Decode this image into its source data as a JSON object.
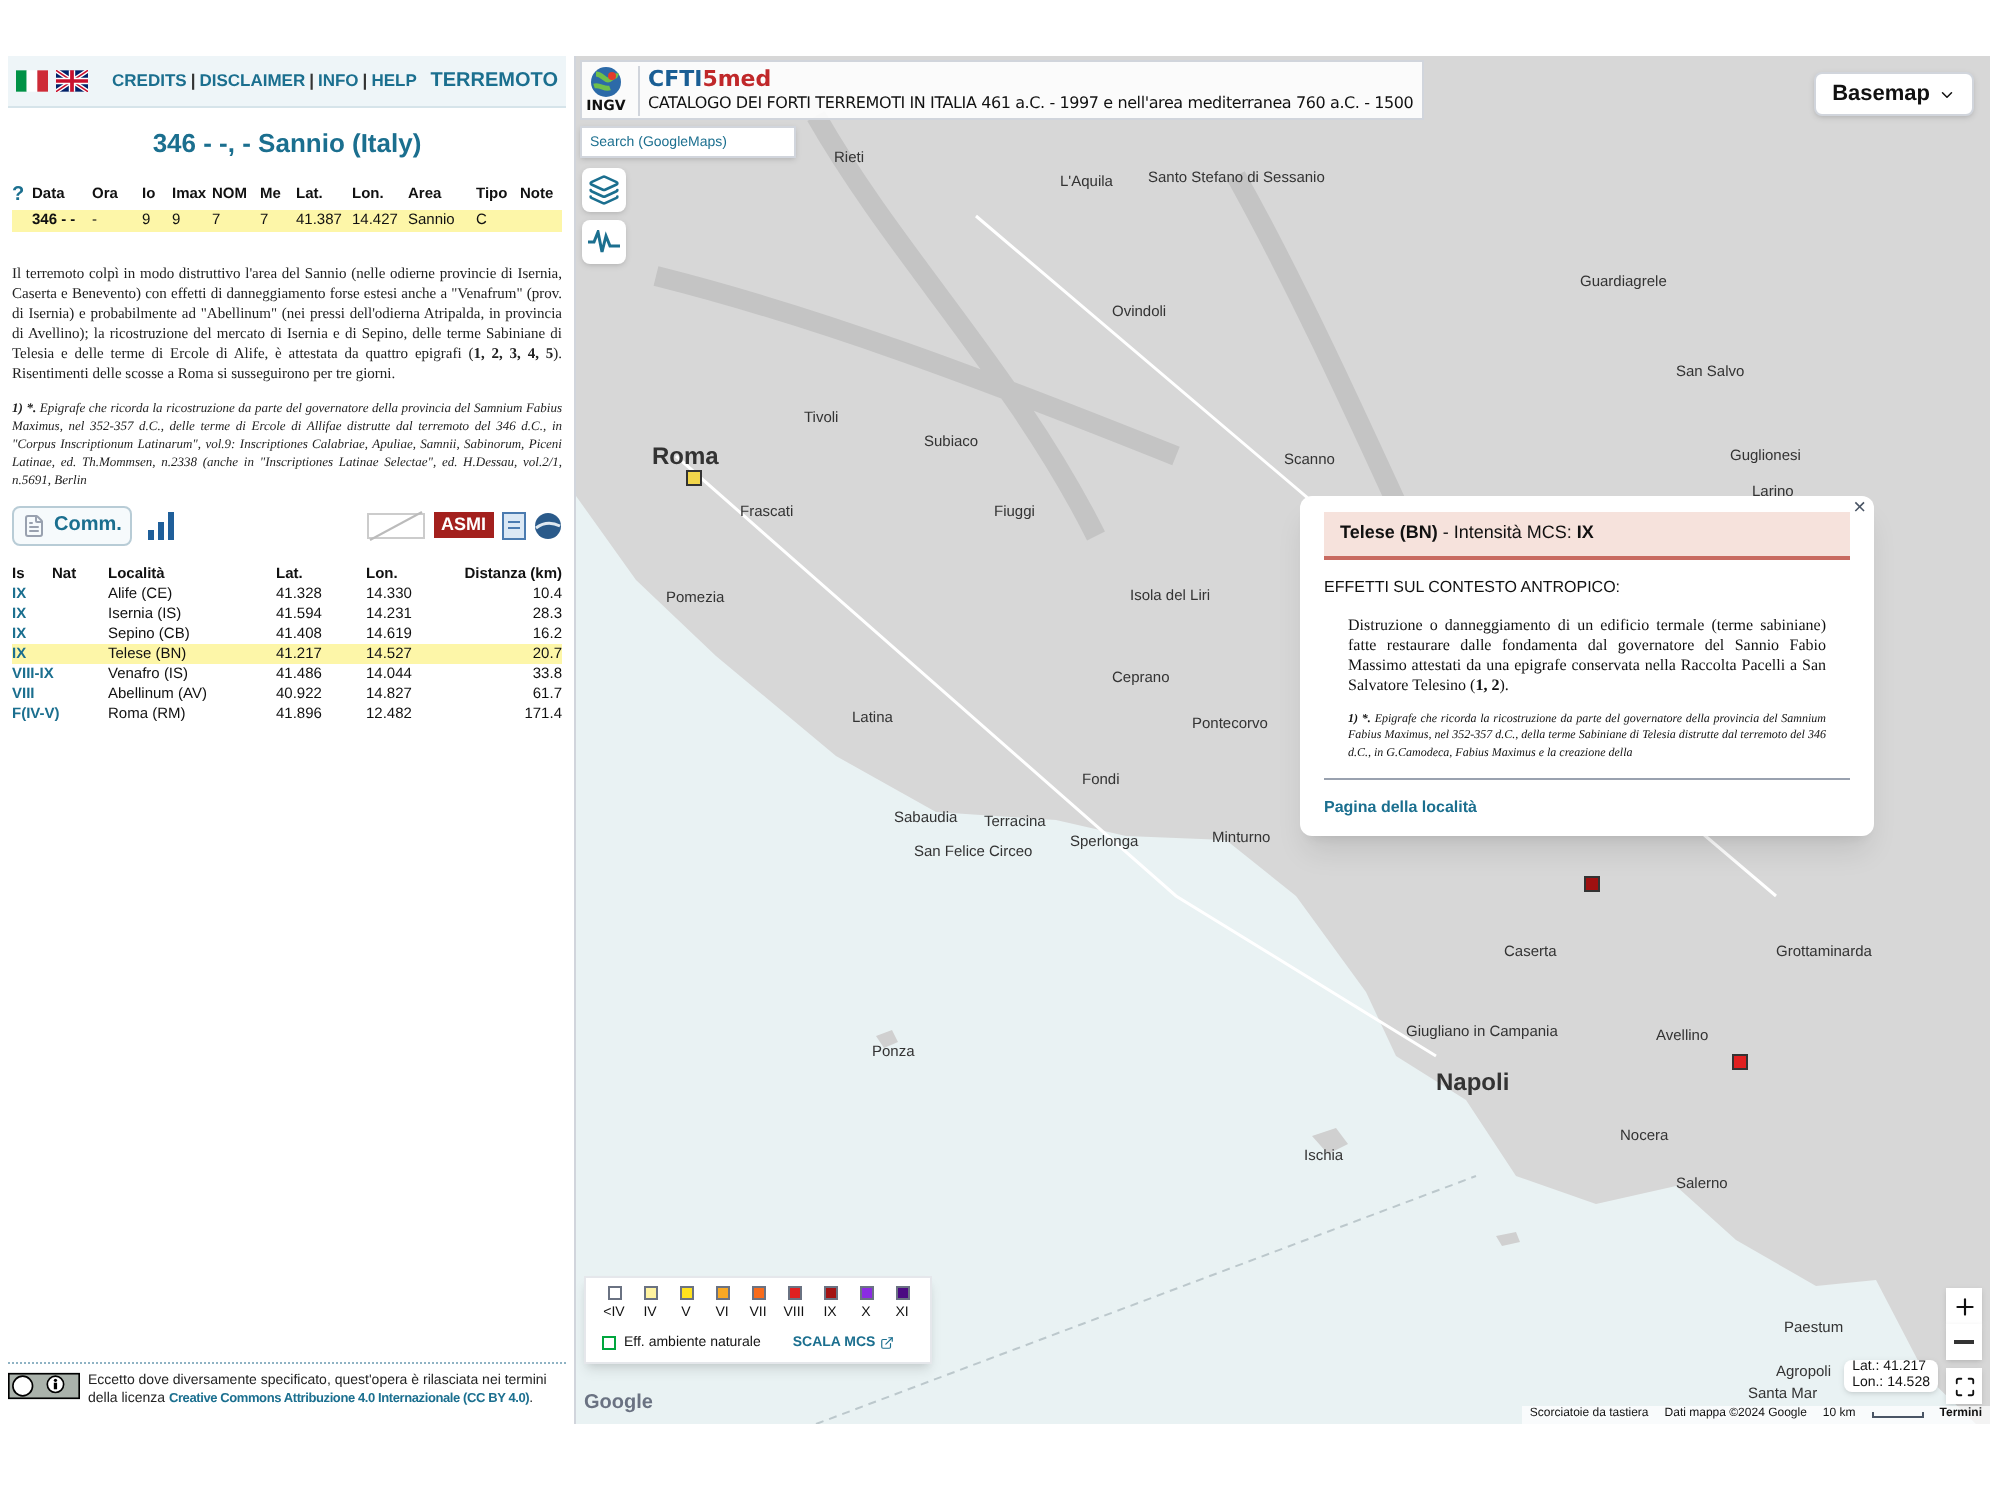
{
  "nav": {
    "links": [
      "CREDITS",
      "DISCLAIMER",
      "INFO",
      "HELP"
    ],
    "separators": [
      "|",
      "|",
      "|"
    ],
    "section": "TERREMOTO"
  },
  "quake": {
    "title": "346 - -, - Sannio (Italy)",
    "help": "?",
    "columns": [
      "Data",
      "Ora",
      "Io",
      "Imax",
      "NOM",
      "Me",
      "Lat.",
      "Lon.",
      "Area",
      "Tipo",
      "Note"
    ],
    "row": [
      "346 - -",
      "-",
      "9",
      "9",
      "7",
      "7",
      "41.387",
      "14.427",
      "Sannio",
      "C"
    ]
  },
  "description": "Il terremoto colpì in modo distruttivo l'area del Sannio (nelle odierne provincie di Isernia, Caserta e Benevento) con effetti di danneggiamento forse estesi anche a \"Venafrum\" (prov. di Isernia) e probabilmente ad \"Abellinum\" (nei pressi dell'odierna Atripalda, in provincia di Avellino); la ricostruzione del mercato di Isernia e di Sepino, delle terme Sabiniane di Telesia e delle terme di Ercole di Alife, è attestata da quattro epigrafi (**1, 2, 3, 4, 5**). Risentimenti delle scosse a Roma si susseguirono per tre giorni.",
  "footnote": {
    "mark": "1) *.",
    "text": "Epigrafe che ricorda la ricostruzione da parte del governatore della provincia del Samnium Fabius Maximus, nel 352-357 d.C., delle terme di Ercole di Allifae distrutte dal terremoto del 346 d.C., in \"Corpus Inscriptionum Latinarum\", vol.9: Inscriptiones Calabriae, Apuliae, Samnii, Sabinorum, Piceni Latinae, ed. Th.Mommsen, n.2338 (anche in \"Inscriptiones Latinae Selectae\", ed. H.Dessau, vol.2/1, n.5691, Berlin"
  },
  "comm_button": "Comm.",
  "logo_text": "ASMI",
  "localities": {
    "columns": [
      "Is",
      "Nat",
      "Località",
      "Lat.",
      "Lon.",
      "Distanza (km)"
    ],
    "rows": [
      {
        "is": "IX",
        "name": "Alife (CE)",
        "lat": "41.328",
        "lon": "14.330",
        "dist": "10.4",
        "selected": false
      },
      {
        "is": "IX",
        "name": "Isernia (IS)",
        "lat": "41.594",
        "lon": "14.231",
        "dist": "28.3",
        "selected": false
      },
      {
        "is": "IX",
        "name": "Sepino (CB)",
        "lat": "41.408",
        "lon": "14.619",
        "dist": "16.2",
        "selected": false
      },
      {
        "is": "IX",
        "name": "Telese (BN)",
        "lat": "41.217",
        "lon": "14.527",
        "dist": "20.7",
        "selected": true
      },
      {
        "is": "VIII-IX",
        "name": "Venafro (IS)",
        "lat": "41.486",
        "lon": "14.044",
        "dist": "33.8",
        "selected": false
      },
      {
        "is": "VIII",
        "name": "Abellinum (AV)",
        "lat": "40.922",
        "lon": "14.827",
        "dist": "61.7",
        "selected": false
      },
      {
        "is": "F(IV-V)",
        "name": "Roma (RM)",
        "lat": "41.896",
        "lon": "12.482",
        "dist": "171.4",
        "selected": false
      }
    ]
  },
  "license": {
    "text": "Eccetto dove diversamente specificato, quest'opera è rilasciata nei termini della licenza ",
    "link": "Creative Commons Attribuzione 4.0 Internazionale (CC BY 4.0)",
    "end": "."
  },
  "map": {
    "logo_text": "INGV",
    "brand": [
      "CFTI",
      "5med"
    ],
    "subtitle": "CATALOGO DEI FORTI TERREMOTI IN ITALIA 461 a.C. - 1997 e nell'area mediterranea 760 a.C. - 1500",
    "search": {
      "placeholder": "Search (GoogleMaps)"
    },
    "basemap": "Basemap",
    "labels": [
      "Rieti",
      "L'Aquila",
      "Santo Stefano di Sessanio",
      "Ovindoli",
      "Guardiagrele",
      "San Salvo",
      "Tivoli",
      "Subiaco",
      "Roma",
      "Scanno",
      "Guglionesi",
      "Larino",
      "Frascati",
      "Fiuggi",
      "Pomezia",
      "Isola del Liri",
      "Ceprano",
      "Latina",
      "Pontecorvo",
      "Fondi",
      "Sabaudia",
      "Terracina",
      "Minturno",
      "Sperlonga",
      "San Felice Circeo",
      "Caserta",
      "Grottaminarda",
      "Giugliano in Campania",
      "Avellino",
      "Ponza",
      "Napoli",
      "Nocera",
      "Ischia",
      "Salerno",
      "Paestum",
      "Agropoli",
      "Santa Mar"
    ],
    "markers": [
      {
        "color": "#f2d64b"
      },
      {
        "color": "#a01010"
      },
      {
        "color": "#e02020"
      }
    ],
    "popup": {
      "close": "×",
      "title": "**Telese (BN)** - Intensità MCS: **IX**",
      "heading": "EFFETTI SUL CONTESTO ANTROPICO:",
      "text": "Distruzione o danneggiamento di un edificio termale (terme sabiniane) fatte restaurare dalle fondamenta dal governatore del Sannio Fabio Massimo attestati da una epigrafe conservata nella Raccolta Pacelli a San Salvatore Telesino (**1, 2**).",
      "note_mark": "1) *.",
      "note": "Epigrafe che ricorda la ricostruzione da parte del governatore della provincia del Samnium Fabius Maximus, nel 352-357 d.C., della terme Sabiniane di Telesia distrutte dal terremoto del 346 d.C., in G.Camodeca, Fabius Maximus e la creazione della",
      "link": "Pagina della località"
    },
    "legend": {
      "levels": [
        {
          "label": "<IV",
          "color": "#ffffff"
        },
        {
          "label": "IV",
          "color": "#fff3a0"
        },
        {
          "label": "V",
          "color": "#ffe21f"
        },
        {
          "label": "VI",
          "color": "#f7a824"
        },
        {
          "label": "VII",
          "color": "#f76b1c"
        },
        {
          "label": "VIII",
          "color": "#e02020"
        },
        {
          "label": "IX",
          "color": "#a31313"
        },
        {
          "label": "X",
          "color": "#8a2be2"
        },
        {
          "label": "XI",
          "color": "#4b0a82"
        }
      ],
      "natural": "Eff. ambiente naturale",
      "scale_link": "SCALA MCS"
    },
    "coords": {
      "lat": "Lat.: 41.217",
      "lon": "Lon.: 14.528"
    },
    "google": "Google",
    "footer": [
      "Scorciatoie da tastiera",
      "Dati mappa ©2024 Google"
    ],
    "scale": "10 km",
    "terms": "Termini"
  }
}
